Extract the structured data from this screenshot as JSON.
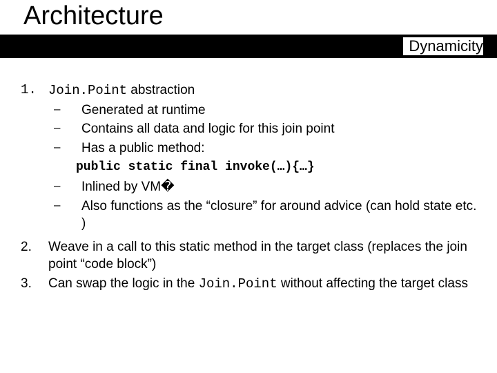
{
  "title": "Architecture",
  "subtitle": "Dynamicity",
  "point1": {
    "number": "1.",
    "term": "Join.Point",
    "rest": " abstraction",
    "bullets_a": [
      "Generated at runtime",
      "Contains all data and logic for this join point",
      "Has a public method:"
    ],
    "code": "public static final invoke(…){…}",
    "bullets_b": [
      "Inlined by VM�",
      "Also functions as the “closure” for around advice (can hold state etc. )"
    ]
  },
  "point2": {
    "number": "2.",
    "text": "Weave in a call to this static method in the target class (replaces the join point “code block”)"
  },
  "point3": {
    "number": "3.",
    "pre": "Can swap the logic in the ",
    "term": "Join.Point",
    "post": " without affecting the target class"
  },
  "dash": "–"
}
